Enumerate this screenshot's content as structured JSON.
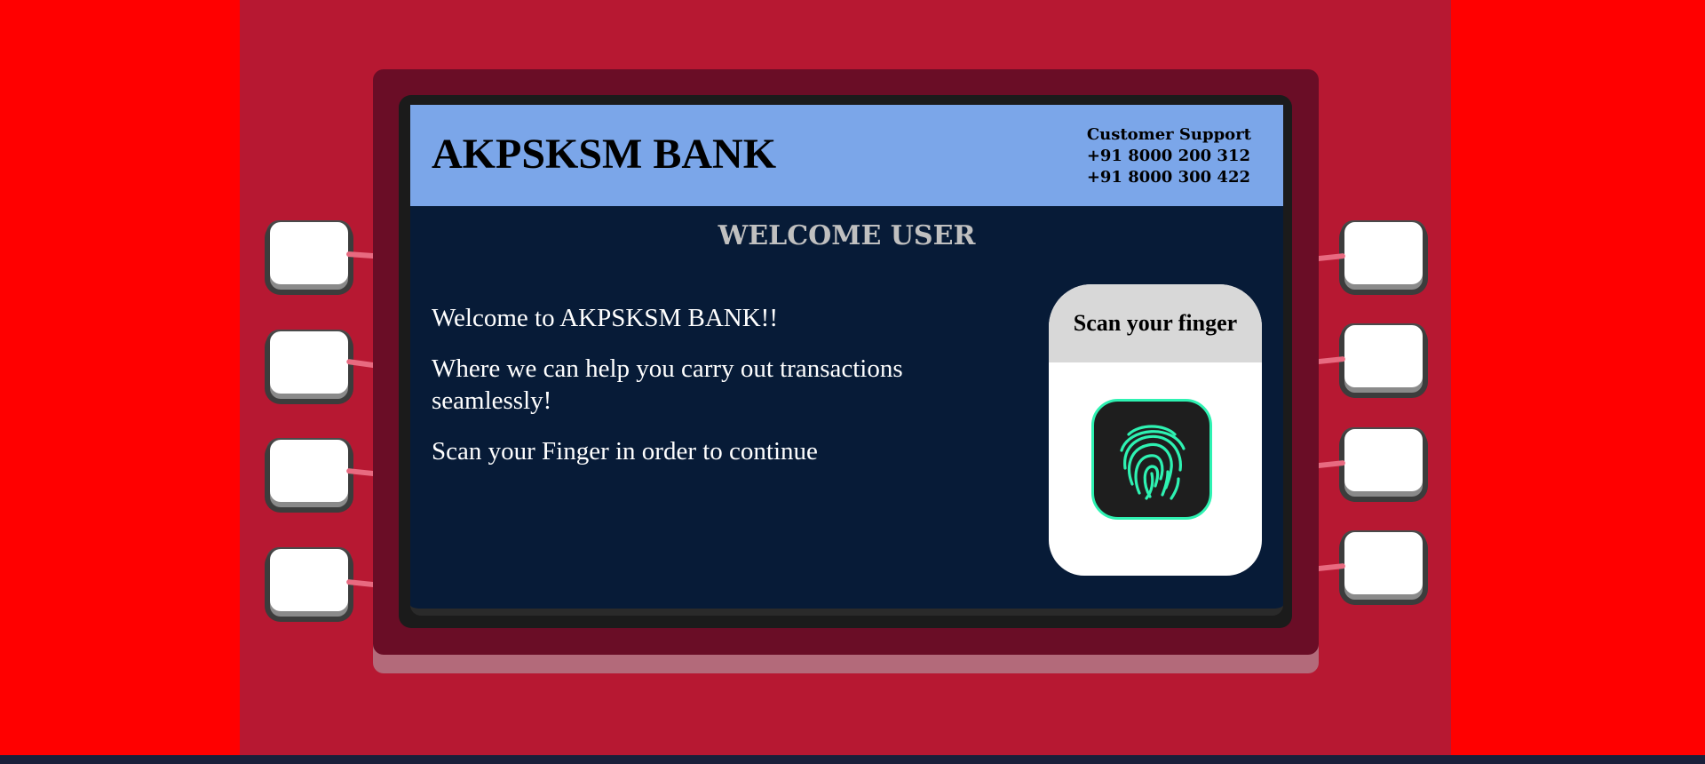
{
  "bank": {
    "name": "AKPSKSM BANK"
  },
  "support": {
    "title": "Customer Support",
    "phone_1": "+91 8000 200 312",
    "phone_2": "+91 8000 300 422"
  },
  "welcome": {
    "title": "WELCOME USER",
    "line_1": "Welcome to AKPSKSM BANK!!",
    "line_2": "Where we can help you carry out transactions seamlessly!",
    "line_3": "Scan your Finger in order to continue"
  },
  "scanner": {
    "title": "Scan your finger",
    "icon": "fingerprint-icon"
  },
  "colors": {
    "page_bg": "#ff0000",
    "atm_body": "#b71832",
    "header_bg": "#7ba6e9",
    "screen_bg": "#071b37",
    "fingerprint_accent": "#2ef2b2"
  }
}
